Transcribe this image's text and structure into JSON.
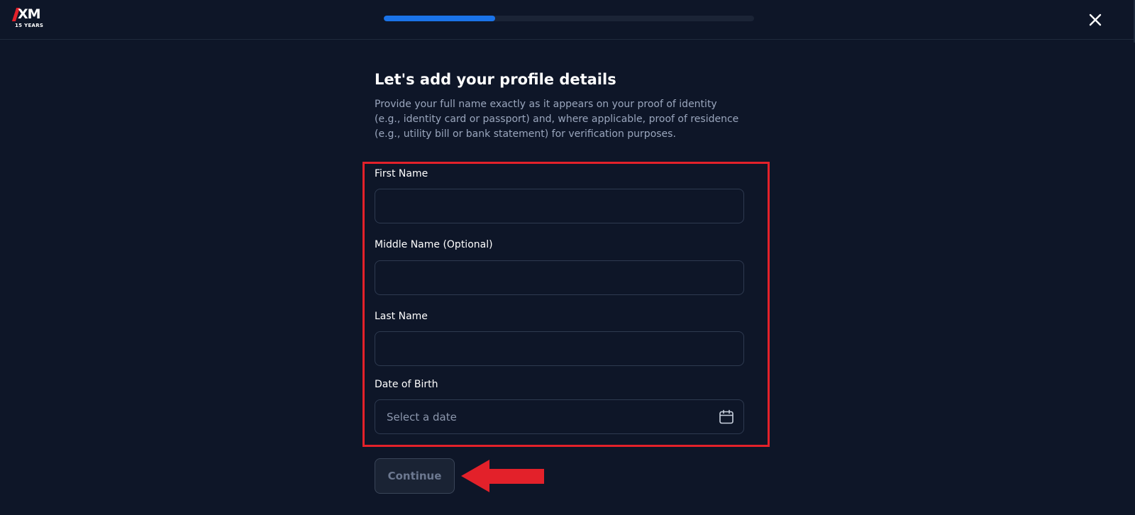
{
  "header": {
    "logo_text": "XM",
    "logo_subtitle": "15 YEARS",
    "progress_percent": 30,
    "close_icon": "close-icon"
  },
  "form": {
    "title": "Let's add your profile details",
    "description": "Provide your full name exactly as it appears on your proof of identity (e.g., identity card or passport) and, where applicable, proof of residence (e.g., utility bill or bank statement) for verification purposes.",
    "fields": {
      "first_name": {
        "label": "First Name",
        "value": "",
        "placeholder": ""
      },
      "middle_name": {
        "label": "Middle Name (Optional)",
        "value": "",
        "placeholder": ""
      },
      "last_name": {
        "label": "Last Name",
        "value": "",
        "placeholder": ""
      },
      "date_of_birth": {
        "label": "Date of Birth",
        "value": "",
        "placeholder": "Select a date",
        "icon": "calendar-icon"
      }
    },
    "continue_label": "Continue"
  },
  "annotations": {
    "highlight_color": "#e3212a",
    "arrow_color": "#e3212a"
  },
  "colors": {
    "background": "#0e1628",
    "accent": "#1a73e8",
    "muted_text": "#9aa6bd",
    "brand_red": "#e3212a"
  }
}
